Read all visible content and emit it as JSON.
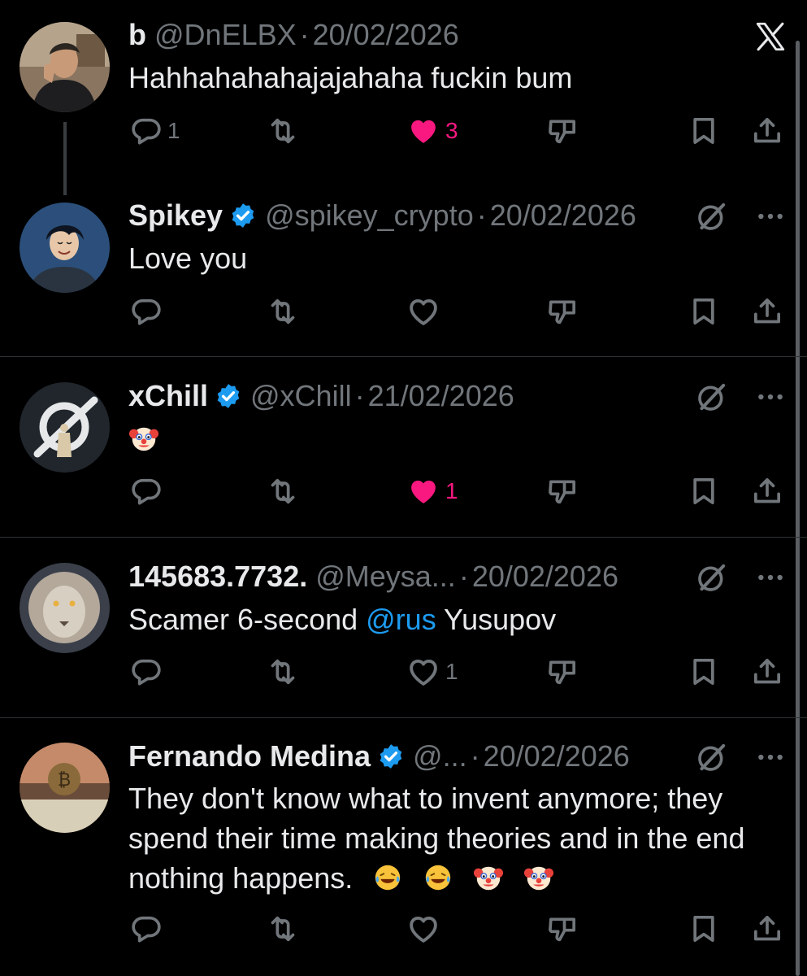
{
  "window": {
    "close_icon": "x-logo-close-icon"
  },
  "posts": [
    {
      "name": "b",
      "handle": "@DnELBX",
      "dot": "·",
      "date": "20/02/2026",
      "text": "Hahhahahahajajahaha fuckin bum",
      "verified": false,
      "reply_count": "1",
      "retweet_count": "",
      "like_count": "3",
      "liked": true
    },
    {
      "name": "Spikey",
      "handle": "@spikey_crypto",
      "dot": "·",
      "date": "20/02/2026",
      "text": "Love you",
      "verified": true,
      "reply_count": "",
      "like_count": "",
      "liked": false
    },
    {
      "name": "xChill",
      "handle": "@xChill",
      "dot": "·",
      "date": "21/02/2026",
      "text": "🤡",
      "verified": true,
      "reply_count": "",
      "like_count": "1",
      "liked": true
    },
    {
      "name": "145683.7732.",
      "handle": "@Meysa...",
      "dot": "·",
      "date": "20/02/2026",
      "text_before": "Scamer 6-second ",
      "mention": "@rus",
      "text_after": " Yusupov",
      "verified": false,
      "reply_count": "",
      "like_count": "1",
      "liked": false
    },
    {
      "name": "Fernando Medina",
      "handle": "@...",
      "dot": "·",
      "date": "20/02/2026",
      "text_line1": "They don't know what to invent anymore; they",
      "text_line2": "spend their time making theories and in the end",
      "text_line3": "nothing happens.",
      "emojis": [
        "😂",
        "😂",
        "🤡",
        "🤡"
      ],
      "verified": true,
      "reply_count": "",
      "like_count": "",
      "liked": false
    }
  ],
  "colors": {
    "background": "#000000",
    "text": "#e7e9ea",
    "secondary": "#71767b",
    "like": "#f91880",
    "verified": "#1d9bf0",
    "divider": "#2f3336"
  }
}
